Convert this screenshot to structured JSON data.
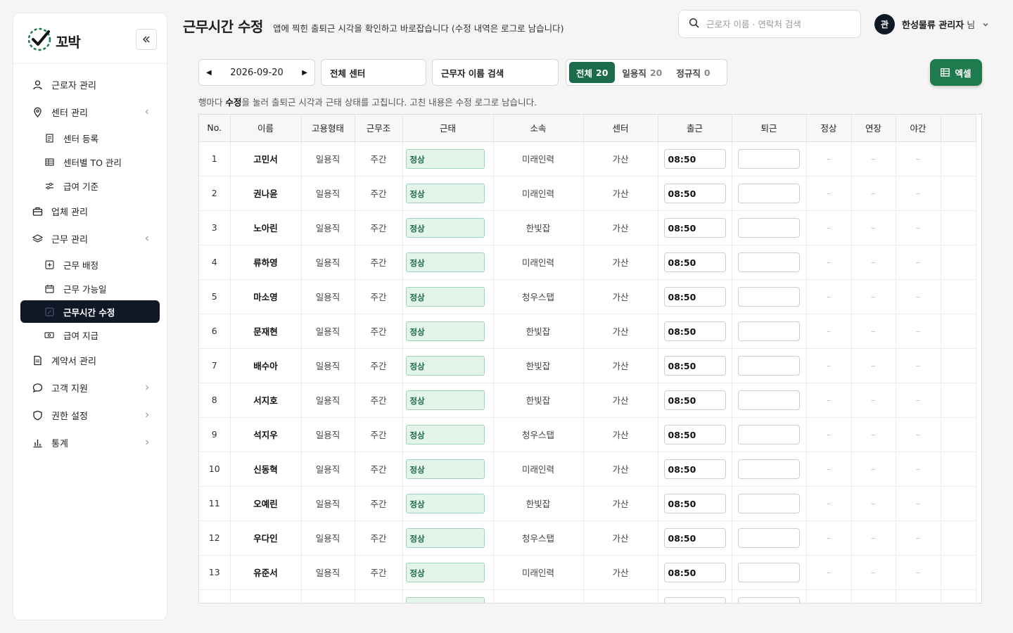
{
  "app": {
    "logo_text": "꼬박"
  },
  "sidebar": {
    "items": [
      {
        "label": "근로자 관리",
        "icon": "user-icon",
        "kind": "item"
      },
      {
        "label": "센터 관리",
        "icon": "location-pin-icon",
        "kind": "item",
        "chevron": "‹"
      },
      {
        "label": "센터 등록",
        "icon": "document-icon",
        "kind": "sub"
      },
      {
        "label": "센터별 TO 관리",
        "icon": "grid-icon",
        "kind": "sub"
      },
      {
        "label": "급여 기준",
        "icon": "sliders-icon",
        "kind": "sub"
      },
      {
        "label": "업체 관리",
        "icon": "briefcase-icon",
        "kind": "item"
      },
      {
        "label": "근무 관리",
        "icon": "layers-icon",
        "kind": "item",
        "chevron": "‹"
      },
      {
        "label": "근무 배정",
        "icon": "plus-square-icon",
        "kind": "sub"
      },
      {
        "label": "근무 가능일",
        "icon": "calendar-icon",
        "kind": "sub"
      },
      {
        "label": "근무시간 수정",
        "icon": "edit-icon",
        "kind": "sub",
        "active": true
      },
      {
        "label": "급여 지급",
        "icon": "cash-icon",
        "kind": "sub"
      },
      {
        "label": "계약서 관리",
        "icon": "contract-icon",
        "kind": "item"
      },
      {
        "label": "고객 지원",
        "icon": "chat-icon",
        "kind": "item",
        "chevron": "›"
      },
      {
        "label": "권한 설정",
        "icon": "shield-icon",
        "kind": "item",
        "chevron": "›"
      },
      {
        "label": "통계",
        "icon": "bar-chart-icon",
        "kind": "item",
        "chevron": "›"
      }
    ]
  },
  "header": {
    "title": "근무시간 수정",
    "subtitle": "앱에 찍힌 출퇴근 시각을 확인하고 바로잡습니다 (수정 내역은 로그로 남습니다)",
    "search_placeholder": "근로자 이름 · 연락처 검색",
    "user_avatar": "관",
    "user_name": "한성물류 관리자",
    "user_suffix": "님"
  },
  "filters": {
    "date": "2026-09-20",
    "center": "전체 센터",
    "worker_search": "근무자 이름 검색",
    "segments": [
      {
        "label": "전체",
        "count": "20",
        "active": true
      },
      {
        "label": "일용직",
        "count": "20",
        "active": false
      },
      {
        "label": "정규직",
        "count": "0",
        "active": false
      }
    ],
    "excel_label": "엑셀"
  },
  "hint": {
    "prefix": "행마다 ",
    "bold": "수정",
    "suffix": "을 눌러 출퇴근 시각과 근태 상태를 고칩니다. 고친 내용은 수정 로그로 남습니다."
  },
  "table": {
    "columns": [
      "No.",
      "이름",
      "고용형태",
      "근무조",
      "근태",
      "소속",
      "센터",
      "출근",
      "퇴근",
      "정상",
      "연장",
      "야간"
    ],
    "rows": [
      {
        "no": "1",
        "name": "고민서",
        "type": "일용직",
        "shift": "주간",
        "status": "정상",
        "org": "미래인력",
        "center": "가산",
        "in": "08:50",
        "out": "",
        "normal": "–",
        "overtime": "–",
        "night": "–"
      },
      {
        "no": "2",
        "name": "권나윤",
        "type": "일용직",
        "shift": "주간",
        "status": "정상",
        "org": "미래인력",
        "center": "가산",
        "in": "08:50",
        "out": "",
        "normal": "–",
        "overtime": "–",
        "night": "–"
      },
      {
        "no": "3",
        "name": "노아린",
        "type": "일용직",
        "shift": "주간",
        "status": "정상",
        "org": "한빛잡",
        "center": "가산",
        "in": "08:50",
        "out": "",
        "normal": "–",
        "overtime": "–",
        "night": "–"
      },
      {
        "no": "4",
        "name": "류하영",
        "type": "일용직",
        "shift": "주간",
        "status": "정상",
        "org": "미래인력",
        "center": "가산",
        "in": "08:50",
        "out": "",
        "normal": "–",
        "overtime": "–",
        "night": "–"
      },
      {
        "no": "5",
        "name": "마소영",
        "type": "일용직",
        "shift": "주간",
        "status": "정상",
        "org": "청우스탭",
        "center": "가산",
        "in": "08:50",
        "out": "",
        "normal": "–",
        "overtime": "–",
        "night": "–"
      },
      {
        "no": "6",
        "name": "문재현",
        "type": "일용직",
        "shift": "주간",
        "status": "정상",
        "org": "한빛잡",
        "center": "가산",
        "in": "08:50",
        "out": "",
        "normal": "–",
        "overtime": "–",
        "night": "–"
      },
      {
        "no": "7",
        "name": "배수아",
        "type": "일용직",
        "shift": "주간",
        "status": "정상",
        "org": "한빛잡",
        "center": "가산",
        "in": "08:50",
        "out": "",
        "normal": "–",
        "overtime": "–",
        "night": "–"
      },
      {
        "no": "8",
        "name": "서지호",
        "type": "일용직",
        "shift": "주간",
        "status": "정상",
        "org": "한빛잡",
        "center": "가산",
        "in": "08:50",
        "out": "",
        "normal": "–",
        "overtime": "–",
        "night": "–"
      },
      {
        "no": "9",
        "name": "석지우",
        "type": "일용직",
        "shift": "주간",
        "status": "정상",
        "org": "청우스탭",
        "center": "가산",
        "in": "08:50",
        "out": "",
        "normal": "–",
        "overtime": "–",
        "night": "–"
      },
      {
        "no": "10",
        "name": "신동혁",
        "type": "일용직",
        "shift": "주간",
        "status": "정상",
        "org": "미래인력",
        "center": "가산",
        "in": "08:50",
        "out": "",
        "normal": "–",
        "overtime": "–",
        "night": "–"
      },
      {
        "no": "11",
        "name": "오예린",
        "type": "일용직",
        "shift": "주간",
        "status": "정상",
        "org": "한빛잡",
        "center": "가산",
        "in": "08:50",
        "out": "",
        "normal": "–",
        "overtime": "–",
        "night": "–"
      },
      {
        "no": "12",
        "name": "우다인",
        "type": "일용직",
        "shift": "주간",
        "status": "정상",
        "org": "청우스탭",
        "center": "가산",
        "in": "08:50",
        "out": "",
        "normal": "–",
        "overtime": "–",
        "night": "–"
      },
      {
        "no": "13",
        "name": "유준서",
        "type": "일용직",
        "shift": "주간",
        "status": "정상",
        "org": "미래인력",
        "center": "가산",
        "in": "08:50",
        "out": "",
        "normal": "–",
        "overtime": "–",
        "night": "–"
      }
    ]
  },
  "colors": {
    "accent": "#1c6b4a",
    "excel": "#1f7a4d",
    "active_nav": "#101828",
    "status_bg": "#e3f4ea"
  }
}
